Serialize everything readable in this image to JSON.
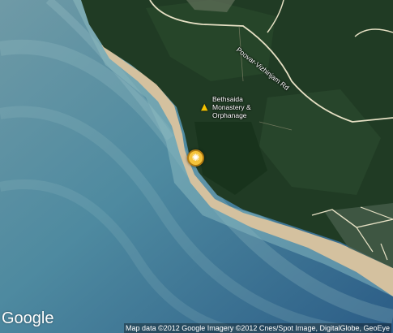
{
  "poi": {
    "icon": "monastery-icon",
    "line1": "Bethsaida",
    "line2": "Monastery &",
    "line3": "Orphanage"
  },
  "road": {
    "label": "Poovar-Vizhinjam Rd"
  },
  "marker": {
    "icon": "sun-icon",
    "color": "#f5c33a"
  },
  "logo": "Google",
  "attribution": "Map data ©2012 Google  Imagery ©2012 Cnes/Spot Image, DigitalGlobe, GeoEye",
  "colors": {
    "sea": "#3a7088",
    "land": "#1f3a22",
    "sand": "#d7c3a0",
    "road": "#e8e2c8"
  }
}
